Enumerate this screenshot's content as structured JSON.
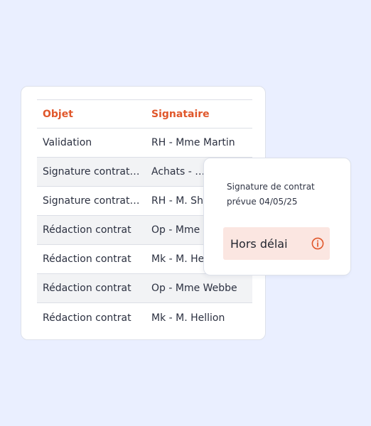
{
  "table": {
    "columns": {
      "objet": "Objet",
      "signataire": "Signataire"
    },
    "rows": [
      {
        "objet": "Validation",
        "signataire": "RH - Mme Martin"
      },
      {
        "objet": "Signature contrat…",
        "signataire": "Achats - …"
      },
      {
        "objet": "Signature contrat…",
        "signataire": "RH - M. Sh"
      },
      {
        "objet": "Rédaction contrat",
        "signataire": "Op - Mme"
      },
      {
        "objet": "Rédaction contrat",
        "signataire": "Mk - M. He"
      },
      {
        "objet": "Rédaction contrat",
        "signataire": "Op - Mme Webbe"
      },
      {
        "objet": "Rédaction contrat",
        "signataire": "Mk - M. Hellion"
      }
    ]
  },
  "popup": {
    "line1": "Signature de contrat",
    "line2": "prévue 04/05/25",
    "badge_label": "Hors délai",
    "badge_icon": "info-icon"
  },
  "colors": {
    "background": "#eaefff",
    "accent": "#e0572b",
    "badge_bg": "#fbe6e1",
    "row_shade": "#f2f3f5"
  }
}
